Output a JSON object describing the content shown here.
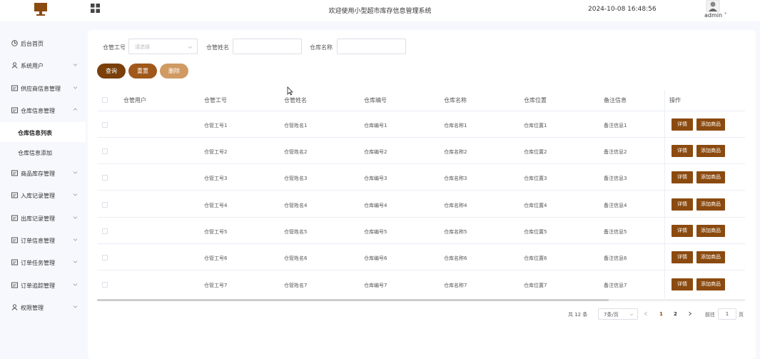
{
  "header": {
    "title": "欢迎使用小型超市库存信息管理系统",
    "datetime": "2024-10-08 16:48:56",
    "user": "admin ˅"
  },
  "colors": {
    "accent_dark": "#7a3f0a",
    "accent": "#a0581b",
    "accent_light": "#d09a63",
    "action": "#8b4a0f",
    "sidebar_bg": "#f6f8fd"
  },
  "sidebar": {
    "items": [
      {
        "label": "后台首页",
        "icon": "clock-icon",
        "chevron": false
      },
      {
        "label": "系统用户",
        "icon": "user-icon",
        "chevron": true
      },
      {
        "label": "供应商信息管理",
        "icon": "list-icon",
        "chevron": true
      },
      {
        "label": "仓库信息管理",
        "icon": "list-icon",
        "chevron": true
      }
    ],
    "sub_items": [
      {
        "label": "仓库信息列表",
        "active": true
      },
      {
        "label": "仓库信息添加",
        "active": false
      }
    ],
    "items_after": [
      {
        "label": "商品库存管理",
        "icon": "list-icon"
      },
      {
        "label": "入库记录管理",
        "icon": "list-icon"
      },
      {
        "label": "出库记录管理",
        "icon": "list-icon"
      },
      {
        "label": "订单信息管理",
        "icon": "list-icon"
      },
      {
        "label": "订单任务管理",
        "icon": "list-icon"
      },
      {
        "label": "订单追踪管理",
        "icon": "list-icon"
      },
      {
        "label": "权限管理",
        "icon": "user-icon"
      }
    ]
  },
  "filters": {
    "manager_no_label": "仓管工号",
    "manager_no_placeholder": "请选择",
    "manager_name_label": "仓管姓名",
    "warehouse_name_label": "仓库名称"
  },
  "buttons": {
    "query": "查询",
    "reset": "重置",
    "delete": "删除"
  },
  "table": {
    "columns": [
      "仓管用户",
      "仓管工号",
      "仓管姓名",
      "仓库编号",
      "仓库名称",
      "仓库位置",
      "备注信息",
      "操作"
    ],
    "rows": [
      [
        "",
        "仓管工号1",
        "仓管姓名1",
        "仓库编号1",
        "仓库名称1",
        "仓库位置1",
        "备注信息1"
      ],
      [
        "",
        "仓管工号2",
        "仓管姓名2",
        "仓库编号2",
        "仓库名称2",
        "仓库位置2",
        "备注信息2"
      ],
      [
        "",
        "仓管工号3",
        "仓管姓名3",
        "仓库编号3",
        "仓库名称3",
        "仓库位置3",
        "备注信息3"
      ],
      [
        "",
        "仓管工号4",
        "仓管姓名4",
        "仓库编号4",
        "仓库名称4",
        "仓库位置4",
        "备注信息4"
      ],
      [
        "",
        "仓管工号5",
        "仓管姓名5",
        "仓库编号5",
        "仓库名称5",
        "仓库位置5",
        "备注信息5"
      ],
      [
        "",
        "仓管工号6",
        "仓管姓名6",
        "仓库编号6",
        "仓库名称6",
        "仓库位置6",
        "备注信息6"
      ],
      [
        "",
        "仓管工号7",
        "仓管姓名7",
        "仓库编号7",
        "仓库名称7",
        "仓库位置7",
        "备注信息7"
      ]
    ],
    "detail_label": "详情",
    "add_goods_label": "添加商品"
  },
  "pagination": {
    "total": "共 12 条",
    "page_size": "7条/页",
    "pages": [
      "1",
      "2"
    ],
    "current_page": "1",
    "goto_label": "前往",
    "goto_value": "1",
    "goto_suffix": "页"
  }
}
